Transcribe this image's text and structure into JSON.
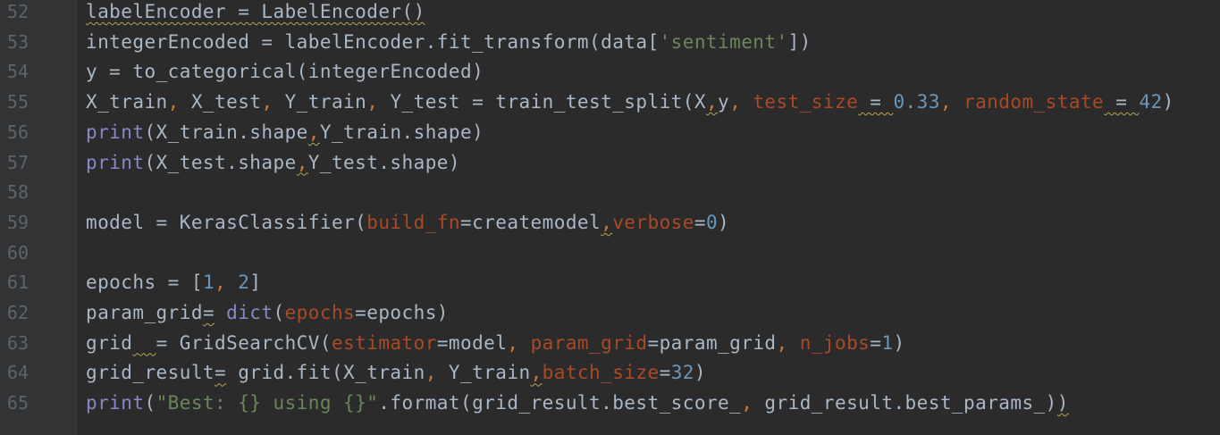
{
  "editor": {
    "colors": {
      "background": "#2b2b2b",
      "gutter": "#313335",
      "line_number": "#606366",
      "plain": "#a9b7c6",
      "builtin": "#8888c6",
      "keyword_punct": "#cc7832",
      "param": "#aa4926",
      "number": "#6897bb",
      "string": "#6a8759"
    },
    "lines": [
      {
        "number": "52",
        "tokens": [
          {
            "t": "labelEncoder = LabelEncoder()",
            "c": "plain",
            "w": true
          }
        ]
      },
      {
        "number": "53",
        "tokens": [
          {
            "t": "integerEncoded = labelEncoder.fit_transform(data[",
            "c": "plain"
          },
          {
            "t": "'sentiment'",
            "c": "str"
          },
          {
            "t": "])",
            "c": "plain"
          }
        ]
      },
      {
        "number": "54",
        "tokens": [
          {
            "t": "y = to_categorical(integerEncoded)",
            "c": "plain"
          }
        ]
      },
      {
        "number": "55",
        "tokens": [
          {
            "t": "X_train",
            "c": "plain"
          },
          {
            "t": ", ",
            "c": "kw"
          },
          {
            "t": "X_test",
            "c": "plain"
          },
          {
            "t": ", ",
            "c": "kw"
          },
          {
            "t": "Y_train",
            "c": "plain"
          },
          {
            "t": ", ",
            "c": "kw"
          },
          {
            "t": "Y_test = train_test_split(X",
            "c": "plain"
          },
          {
            "t": ",",
            "c": "kw",
            "w": true
          },
          {
            "t": "y",
            "c": "plain"
          },
          {
            "t": ", ",
            "c": "kw"
          },
          {
            "t": "test_size",
            "c": "param"
          },
          {
            "t": " = ",
            "c": "plain",
            "w": true
          },
          {
            "t": "0.33",
            "c": "num"
          },
          {
            "t": ", ",
            "c": "kw"
          },
          {
            "t": "random_state",
            "c": "param"
          },
          {
            "t": " = ",
            "c": "plain",
            "w": true
          },
          {
            "t": "42",
            "c": "num"
          },
          {
            "t": ")",
            "c": "plain"
          }
        ]
      },
      {
        "number": "56",
        "tokens": [
          {
            "t": "print",
            "c": "builtin"
          },
          {
            "t": "(X_train.shape",
            "c": "plain"
          },
          {
            "t": ",",
            "c": "kw",
            "w": true
          },
          {
            "t": "Y_train.shape)",
            "c": "plain"
          }
        ]
      },
      {
        "number": "57",
        "tokens": [
          {
            "t": "print",
            "c": "builtin"
          },
          {
            "t": "(X_test.shape",
            "c": "plain"
          },
          {
            "t": ",",
            "c": "kw",
            "w": true
          },
          {
            "t": "Y_test.shape)",
            "c": "plain"
          }
        ]
      },
      {
        "number": "58",
        "tokens": []
      },
      {
        "number": "59",
        "tokens": [
          {
            "t": "model = KerasClassifier(",
            "c": "plain"
          },
          {
            "t": "build_fn",
            "c": "param"
          },
          {
            "t": "=createmodel",
            "c": "plain"
          },
          {
            "t": ",",
            "c": "kw",
            "w": true
          },
          {
            "t": "verbose",
            "c": "param"
          },
          {
            "t": "=",
            "c": "plain"
          },
          {
            "t": "0",
            "c": "num"
          },
          {
            "t": ")",
            "c": "plain"
          }
        ]
      },
      {
        "number": "60",
        "tokens": []
      },
      {
        "number": "61",
        "tokens": [
          {
            "t": "epochs = [",
            "c": "plain"
          },
          {
            "t": "1",
            "c": "num"
          },
          {
            "t": ", ",
            "c": "kw"
          },
          {
            "t": "2",
            "c": "num"
          },
          {
            "t": "]",
            "c": "plain"
          }
        ]
      },
      {
        "number": "62",
        "tokens": [
          {
            "t": "param_grid",
            "c": "plain"
          },
          {
            "t": "=",
            "c": "plain",
            "w": true
          },
          {
            "t": " ",
            "c": "plain"
          },
          {
            "t": "dict",
            "c": "builtin"
          },
          {
            "t": "(",
            "c": "plain"
          },
          {
            "t": "epochs",
            "c": "param"
          },
          {
            "t": "=epochs)",
            "c": "plain"
          }
        ]
      },
      {
        "number": "63",
        "tokens": [
          {
            "t": "grid",
            "c": "plain"
          },
          {
            "t": "  ",
            "c": "plain",
            "w": true
          },
          {
            "t": "= GridSearchCV(",
            "c": "plain"
          },
          {
            "t": "estimator",
            "c": "param"
          },
          {
            "t": "=model",
            "c": "plain"
          },
          {
            "t": ", ",
            "c": "kw"
          },
          {
            "t": "param_grid",
            "c": "param"
          },
          {
            "t": "=param_grid",
            "c": "plain"
          },
          {
            "t": ", ",
            "c": "kw"
          },
          {
            "t": "n_jobs",
            "c": "param"
          },
          {
            "t": "=",
            "c": "plain"
          },
          {
            "t": "1",
            "c": "num"
          },
          {
            "t": ")",
            "c": "plain"
          }
        ]
      },
      {
        "number": "64",
        "tokens": [
          {
            "t": "grid_result",
            "c": "plain"
          },
          {
            "t": "=",
            "c": "plain",
            "w": true
          },
          {
            "t": " grid.fit(X_train",
            "c": "plain"
          },
          {
            "t": ", ",
            "c": "kw"
          },
          {
            "t": "Y_train",
            "c": "plain"
          },
          {
            "t": ",",
            "c": "kw",
            "w": true
          },
          {
            "t": "batch_size",
            "c": "param"
          },
          {
            "t": "=",
            "c": "plain"
          },
          {
            "t": "32",
            "c": "num"
          },
          {
            "t": ")",
            "c": "plain"
          }
        ]
      },
      {
        "number": "65",
        "tokens": [
          {
            "t": "print",
            "c": "builtin"
          },
          {
            "t": "(",
            "c": "plain"
          },
          {
            "t": "\"Best: {} using {}\"",
            "c": "str"
          },
          {
            "t": ".format(grid_result.best_score_",
            "c": "plain"
          },
          {
            "t": ", ",
            "c": "kw"
          },
          {
            "t": "grid_result.best_params_)",
            "c": "plain"
          },
          {
            "t": ")",
            "c": "plain",
            "w": true
          }
        ]
      }
    ]
  }
}
